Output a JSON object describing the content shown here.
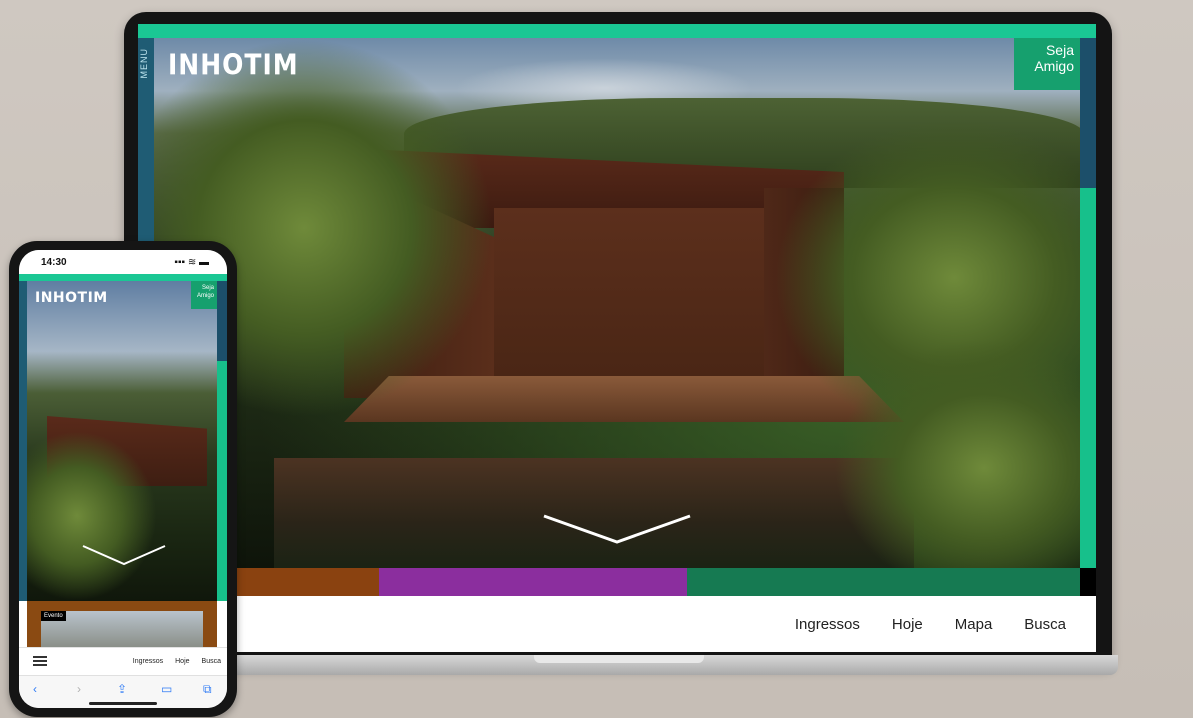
{
  "laptop": {
    "logo": "INHOTIM",
    "menu_label": "MENU",
    "cta_lines": [
      "Seja",
      "Amigo"
    ],
    "color_band": [
      "#8a4210",
      "#8b2e9e",
      "#167a52"
    ],
    "nav_items": [
      "Ingressos",
      "Hoje",
      "Mapa",
      "Busca"
    ],
    "accent": "#1ac794"
  },
  "phone": {
    "status_time": "14:30",
    "status_icons": "▪▪▪ ≋ ▬",
    "logo": "INHOTIM",
    "cta_lines": [
      "Seja",
      "Amigo"
    ],
    "card_tag": "Evento",
    "nav_items": [
      "Ingressos",
      "Hoje",
      "Busca"
    ],
    "browser_icons": [
      "back-icon",
      "forward-icon",
      "share-icon",
      "bookmarks-icon",
      "tabs-icon"
    ]
  }
}
